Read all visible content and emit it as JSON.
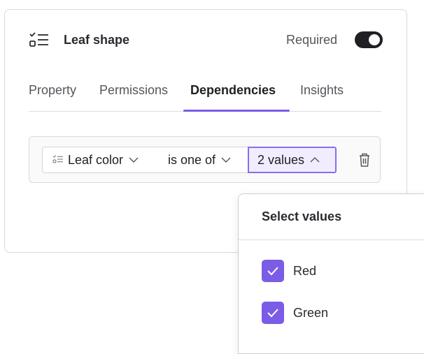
{
  "header": {
    "title": "Leaf shape",
    "required_label": "Required",
    "required_on": true
  },
  "tabs": [
    {
      "label": "Property",
      "active": false
    },
    {
      "label": "Permissions",
      "active": false
    },
    {
      "label": "Dependencies",
      "active": true
    },
    {
      "label": "Insights",
      "active": false
    }
  ],
  "rule": {
    "field_label": "Leaf color",
    "operator_label": "is one of",
    "values_label": "2 values"
  },
  "dropdown": {
    "title": "Select values",
    "options": [
      {
        "label": "Red",
        "checked": true
      },
      {
        "label": "Green",
        "checked": true
      }
    ]
  },
  "colors": {
    "accent": "#7b5ce6",
    "toggle_on": "#1f1f24"
  }
}
